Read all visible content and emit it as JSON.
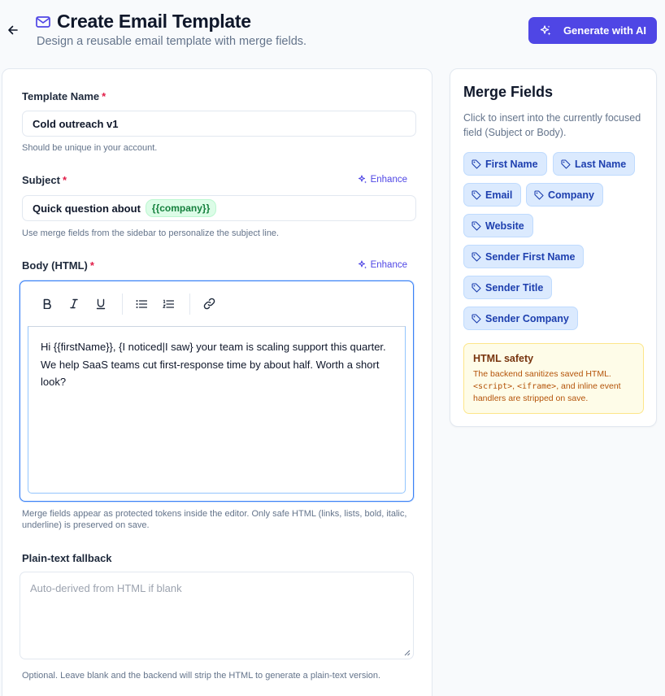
{
  "header": {
    "title": "Create Email Template",
    "subtitle": "Design a reusable email template with merge fields.",
    "ai_button_label": "Generate with AI"
  },
  "form": {
    "template_name": {
      "label": "Template Name",
      "required_mark": "*",
      "value": "Cold outreach v1",
      "hint": "Should be unique in your account."
    },
    "subject": {
      "label": "Subject",
      "required_mark": "*",
      "enhance_label": "Enhance",
      "value_text": "Quick question about",
      "value_token": "{{company}}",
      "hint": "Use merge fields from the sidebar to personalize the subject line."
    },
    "body": {
      "label": "Body (HTML)",
      "required_mark": "*",
      "enhance_label": "Enhance",
      "content": "Hi {{firstName}}, {I noticed|I saw} your team is scaling support this quarter. We help SaaS teams cut first-response time by about half. Worth a short look?",
      "hint": "Merge fields appear as protected tokens inside the editor. Only safe HTML (links, lists, bold, italic, underline) is preserved on save.",
      "toolbar": [
        "B",
        "I",
        "U",
        "bulleted-list",
        "numbered-list",
        "link"
      ]
    },
    "plain_text": {
      "label": "Plain-text fallback",
      "placeholder": "Auto-derived from HTML if blank",
      "value": "",
      "hint": "Optional. Leave blank and the backend will strip the HTML to generate a plain-text version."
    }
  },
  "sidebar": {
    "title": "Merge Fields",
    "description": "Click to insert into the currently focused field (Subject or Body).",
    "fields": [
      "First Name",
      "Last Name",
      "Email",
      "Company",
      "Website",
      "Sender First Name",
      "Sender Title",
      "Sender Company"
    ],
    "notice": {
      "title": "HTML safety",
      "text_before": "The backend sanitizes saved HTML. ",
      "code1": "<script>",
      "sep": ", ",
      "code2": "<iframe>",
      "text_after": ", and inline event handlers are stripped on save."
    }
  },
  "colors": {
    "accent": "#4f46e5",
    "required": "#e11d48",
    "chip_bg": "#dbeafe",
    "token_bg": "#dcfce7",
    "notice_bg": "#fefce8"
  }
}
